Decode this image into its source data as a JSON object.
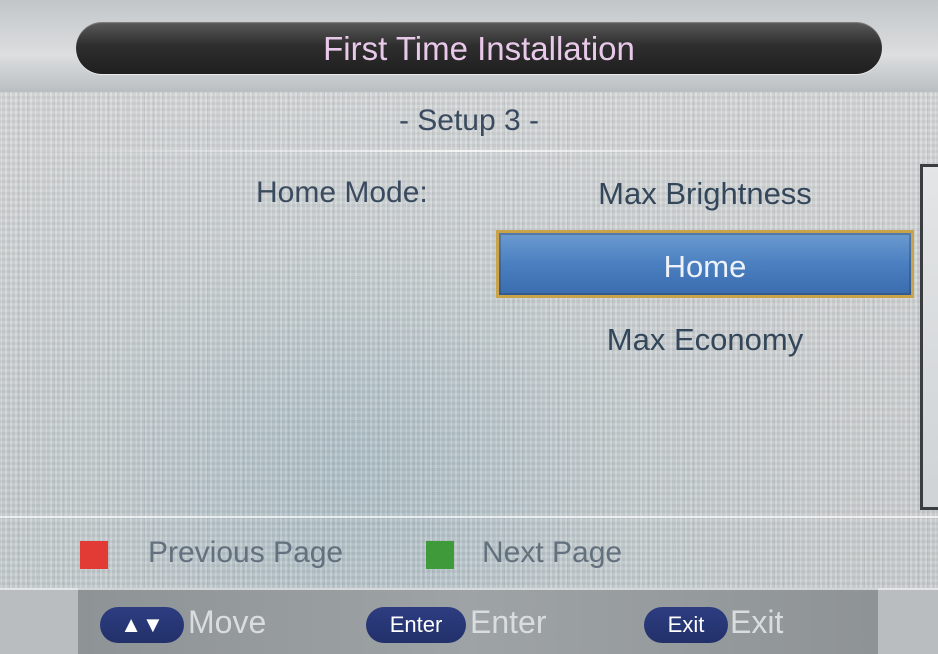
{
  "header": {
    "title": "First Time Installation"
  },
  "setup": {
    "subtitle": "- Setup 3 -",
    "field_label": "Home Mode:",
    "options": [
      "Max Brightness",
      "Home",
      "Max Economy"
    ],
    "selected": "Home"
  },
  "hints": {
    "previous": {
      "label": "Previous Page",
      "color": "#e23a34"
    },
    "next": {
      "label": "Next Page",
      "color": "#3f9a39"
    }
  },
  "footer": {
    "move": {
      "key": "▲▼",
      "label": "Move"
    },
    "enter": {
      "key": "Enter",
      "label": "Enter"
    },
    "exit": {
      "key": "Exit",
      "label": "Exit"
    }
  },
  "colors": {
    "accent": "#4a7fc0",
    "selection_border": "#c9a34a",
    "title_text": "#e9c9ea"
  }
}
